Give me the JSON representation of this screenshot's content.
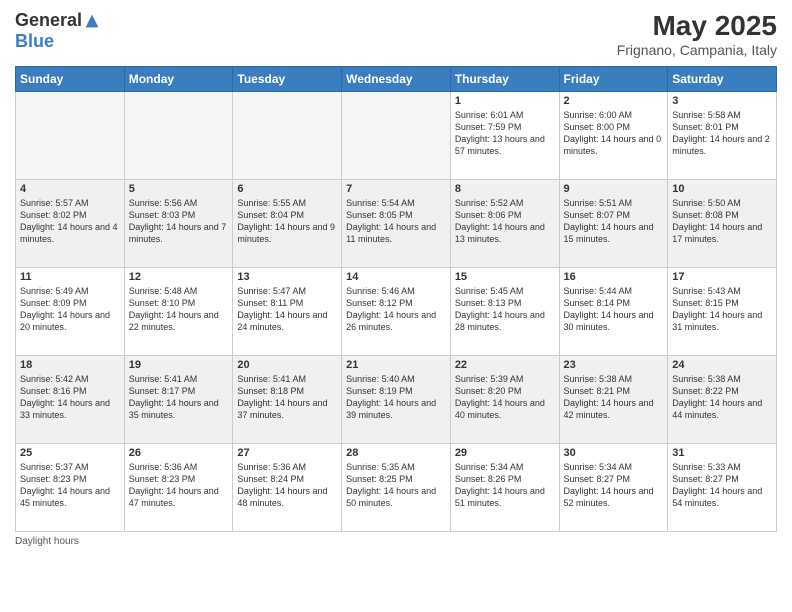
{
  "header": {
    "logo_general": "General",
    "logo_blue": "Blue",
    "month_title": "May 2025",
    "location": "Frignano, Campania, Italy"
  },
  "footer": {
    "note": "Daylight hours"
  },
  "days_of_week": [
    "Sunday",
    "Monday",
    "Tuesday",
    "Wednesday",
    "Thursday",
    "Friday",
    "Saturday"
  ],
  "weeks": [
    [
      {
        "day": "",
        "empty": true
      },
      {
        "day": "",
        "empty": true
      },
      {
        "day": "",
        "empty": true
      },
      {
        "day": "",
        "empty": true
      },
      {
        "day": "1",
        "sunrise": "Sunrise: 6:01 AM",
        "sunset": "Sunset: 7:59 PM",
        "daylight": "Daylight: 13 hours and 57 minutes."
      },
      {
        "day": "2",
        "sunrise": "Sunrise: 6:00 AM",
        "sunset": "Sunset: 8:00 PM",
        "daylight": "Daylight: 14 hours and 0 minutes."
      },
      {
        "day": "3",
        "sunrise": "Sunrise: 5:58 AM",
        "sunset": "Sunset: 8:01 PM",
        "daylight": "Daylight: 14 hours and 2 minutes."
      }
    ],
    [
      {
        "day": "4",
        "sunrise": "Sunrise: 5:57 AM",
        "sunset": "Sunset: 8:02 PM",
        "daylight": "Daylight: 14 hours and 4 minutes."
      },
      {
        "day": "5",
        "sunrise": "Sunrise: 5:56 AM",
        "sunset": "Sunset: 8:03 PM",
        "daylight": "Daylight: 14 hours and 7 minutes."
      },
      {
        "day": "6",
        "sunrise": "Sunrise: 5:55 AM",
        "sunset": "Sunset: 8:04 PM",
        "daylight": "Daylight: 14 hours and 9 minutes."
      },
      {
        "day": "7",
        "sunrise": "Sunrise: 5:54 AM",
        "sunset": "Sunset: 8:05 PM",
        "daylight": "Daylight: 14 hours and 11 minutes."
      },
      {
        "day": "8",
        "sunrise": "Sunrise: 5:52 AM",
        "sunset": "Sunset: 8:06 PM",
        "daylight": "Daylight: 14 hours and 13 minutes."
      },
      {
        "day": "9",
        "sunrise": "Sunrise: 5:51 AM",
        "sunset": "Sunset: 8:07 PM",
        "daylight": "Daylight: 14 hours and 15 minutes."
      },
      {
        "day": "10",
        "sunrise": "Sunrise: 5:50 AM",
        "sunset": "Sunset: 8:08 PM",
        "daylight": "Daylight: 14 hours and 17 minutes."
      }
    ],
    [
      {
        "day": "11",
        "sunrise": "Sunrise: 5:49 AM",
        "sunset": "Sunset: 8:09 PM",
        "daylight": "Daylight: 14 hours and 20 minutes."
      },
      {
        "day": "12",
        "sunrise": "Sunrise: 5:48 AM",
        "sunset": "Sunset: 8:10 PM",
        "daylight": "Daylight: 14 hours and 22 minutes."
      },
      {
        "day": "13",
        "sunrise": "Sunrise: 5:47 AM",
        "sunset": "Sunset: 8:11 PM",
        "daylight": "Daylight: 14 hours and 24 minutes."
      },
      {
        "day": "14",
        "sunrise": "Sunrise: 5:46 AM",
        "sunset": "Sunset: 8:12 PM",
        "daylight": "Daylight: 14 hours and 26 minutes."
      },
      {
        "day": "15",
        "sunrise": "Sunrise: 5:45 AM",
        "sunset": "Sunset: 8:13 PM",
        "daylight": "Daylight: 14 hours and 28 minutes."
      },
      {
        "day": "16",
        "sunrise": "Sunrise: 5:44 AM",
        "sunset": "Sunset: 8:14 PM",
        "daylight": "Daylight: 14 hours and 30 minutes."
      },
      {
        "day": "17",
        "sunrise": "Sunrise: 5:43 AM",
        "sunset": "Sunset: 8:15 PM",
        "daylight": "Daylight: 14 hours and 31 minutes."
      }
    ],
    [
      {
        "day": "18",
        "sunrise": "Sunrise: 5:42 AM",
        "sunset": "Sunset: 8:16 PM",
        "daylight": "Daylight: 14 hours and 33 minutes."
      },
      {
        "day": "19",
        "sunrise": "Sunrise: 5:41 AM",
        "sunset": "Sunset: 8:17 PM",
        "daylight": "Daylight: 14 hours and 35 minutes."
      },
      {
        "day": "20",
        "sunrise": "Sunrise: 5:41 AM",
        "sunset": "Sunset: 8:18 PM",
        "daylight": "Daylight: 14 hours and 37 minutes."
      },
      {
        "day": "21",
        "sunrise": "Sunrise: 5:40 AM",
        "sunset": "Sunset: 8:19 PM",
        "daylight": "Daylight: 14 hours and 39 minutes."
      },
      {
        "day": "22",
        "sunrise": "Sunrise: 5:39 AM",
        "sunset": "Sunset: 8:20 PM",
        "daylight": "Daylight: 14 hours and 40 minutes."
      },
      {
        "day": "23",
        "sunrise": "Sunrise: 5:38 AM",
        "sunset": "Sunset: 8:21 PM",
        "daylight": "Daylight: 14 hours and 42 minutes."
      },
      {
        "day": "24",
        "sunrise": "Sunrise: 5:38 AM",
        "sunset": "Sunset: 8:22 PM",
        "daylight": "Daylight: 14 hours and 44 minutes."
      }
    ],
    [
      {
        "day": "25",
        "sunrise": "Sunrise: 5:37 AM",
        "sunset": "Sunset: 8:23 PM",
        "daylight": "Daylight: 14 hours and 45 minutes."
      },
      {
        "day": "26",
        "sunrise": "Sunrise: 5:36 AM",
        "sunset": "Sunset: 8:23 PM",
        "daylight": "Daylight: 14 hours and 47 minutes."
      },
      {
        "day": "27",
        "sunrise": "Sunrise: 5:36 AM",
        "sunset": "Sunset: 8:24 PM",
        "daylight": "Daylight: 14 hours and 48 minutes."
      },
      {
        "day": "28",
        "sunrise": "Sunrise: 5:35 AM",
        "sunset": "Sunset: 8:25 PM",
        "daylight": "Daylight: 14 hours and 50 minutes."
      },
      {
        "day": "29",
        "sunrise": "Sunrise: 5:34 AM",
        "sunset": "Sunset: 8:26 PM",
        "daylight": "Daylight: 14 hours and 51 minutes."
      },
      {
        "day": "30",
        "sunrise": "Sunrise: 5:34 AM",
        "sunset": "Sunset: 8:27 PM",
        "daylight": "Daylight: 14 hours and 52 minutes."
      },
      {
        "day": "31",
        "sunrise": "Sunrise: 5:33 AM",
        "sunset": "Sunset: 8:27 PM",
        "daylight": "Daylight: 14 hours and 54 minutes."
      }
    ]
  ]
}
